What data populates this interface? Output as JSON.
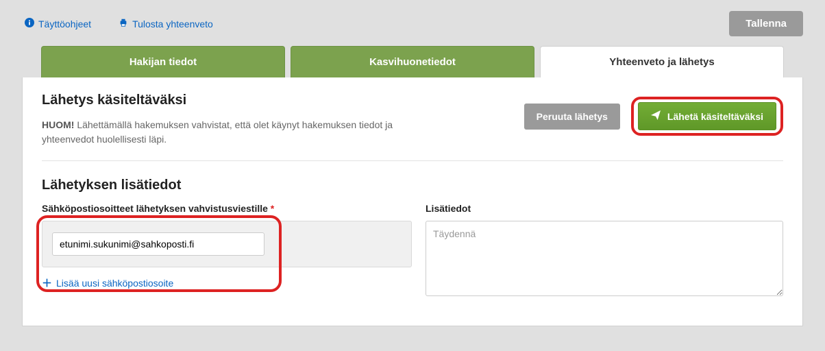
{
  "topbar": {
    "instructions_label": "Täyttöohjeet",
    "print_label": "Tulosta yhteenveto",
    "save_label": "Tallenna"
  },
  "tabs": {
    "tab1": "Hakijan tiedot",
    "tab2": "Kasvihuonetiedot",
    "tab3": "Yhteenveto ja lähetys"
  },
  "submit": {
    "heading": "Lähetys käsiteltäväksi",
    "note_strong": "HUOM!",
    "note_text": " Lähettämällä hakemuksen vahvistat, että olet käynyt hakemuksen tiedot ja yhteenvedot huolellisesti läpi.",
    "cancel_label": "Peruuta lähetys",
    "submit_label": "Lähetä käsiteltäväksi"
  },
  "details": {
    "heading": "Lähetyksen lisätiedot",
    "email_label": "Sähköpostiosoitteet lähetyksen vahvistusviestille",
    "email_value": "etunimi.sukunimi@sahkoposti.fi",
    "add_email_label": "Lisää uusi sähköpostiosoite",
    "extra_label": "Lisätiedot",
    "extra_placeholder": "Täydennä"
  }
}
